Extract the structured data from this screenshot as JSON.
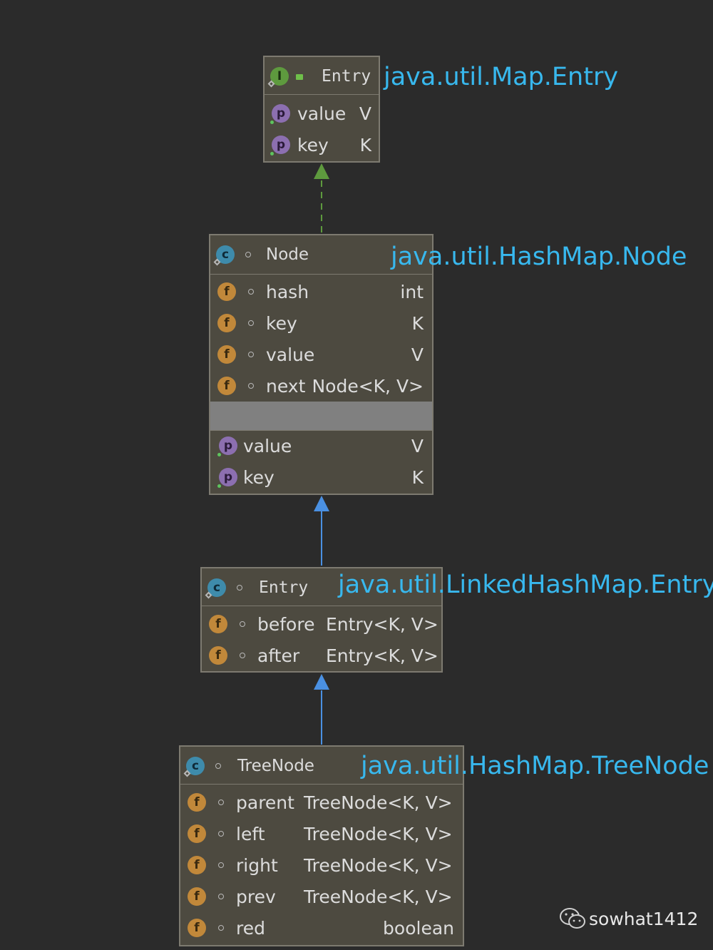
{
  "map_entry": {
    "name": "Entry",
    "package": "java.util.Map.Entry",
    "props": [
      {
        "name": "value",
        "type": "V"
      },
      {
        "name": "key",
        "type": "K"
      }
    ]
  },
  "hashmap_node": {
    "name": "Node",
    "package": "java.util.HashMap.Node",
    "fields": [
      {
        "name": "hash",
        "type": "int"
      },
      {
        "name": "key",
        "type": "K"
      },
      {
        "name": "value",
        "type": "V"
      },
      {
        "name": "next",
        "type": "Node<K, V>"
      }
    ],
    "props": [
      {
        "name": "value",
        "type": "V"
      },
      {
        "name": "key",
        "type": "K"
      }
    ]
  },
  "linked_entry": {
    "name": "Entry",
    "package": "java.util.LinkedHashMap.Entry",
    "fields": [
      {
        "name": "before",
        "type": "Entry<K, V>"
      },
      {
        "name": "after",
        "type": "Entry<K, V>"
      }
    ]
  },
  "tree_node": {
    "name": "TreeNode",
    "package": "java.util.HashMap.TreeNode",
    "fields": [
      {
        "name": "parent",
        "type": "TreeNode<K, V>"
      },
      {
        "name": "left",
        "type": "TreeNode<K, V>"
      },
      {
        "name": "right",
        "type": "TreeNode<K, V>"
      },
      {
        "name": "prev",
        "type": "TreeNode<K, V>"
      },
      {
        "name": "red",
        "type": "boolean"
      }
    ]
  },
  "icons": {
    "field": "f",
    "property": "p",
    "class": "c",
    "interface": "I"
  },
  "watermark": "sowhat1412",
  "colors": {
    "background": "#2b2b2b",
    "box_fill": "#4d4a40",
    "package_label": "#38b8ee",
    "implements_arrow": "#5e9a3e",
    "extends_arrow": "#4a90e2"
  }
}
